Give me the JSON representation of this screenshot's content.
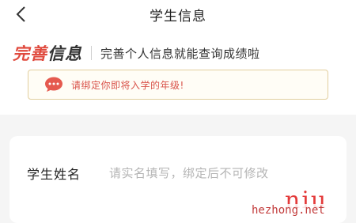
{
  "header": {
    "title": "学生信息",
    "back_icon": "chevron-left-icon"
  },
  "headline": {
    "brand_part1": "完善",
    "brand_part2": "信息",
    "tagline": "完善个人信息就能查询成绩啦"
  },
  "notice": {
    "icon": "chat-bubble-icon",
    "text": "请绑定你即将入学的年级!"
  },
  "form": {
    "name_label": "学生姓名",
    "name_value": "",
    "name_placeholder": "请实名填写，绑定后不可修改"
  },
  "watermark": {
    "mark": "niu",
    "site": "hezhong.net"
  },
  "colors": {
    "accent_red": "#e04a3e",
    "notice_border": "#e2cf9e",
    "notice_text": "#d9534a",
    "watermark_red": "#e43b3b"
  }
}
